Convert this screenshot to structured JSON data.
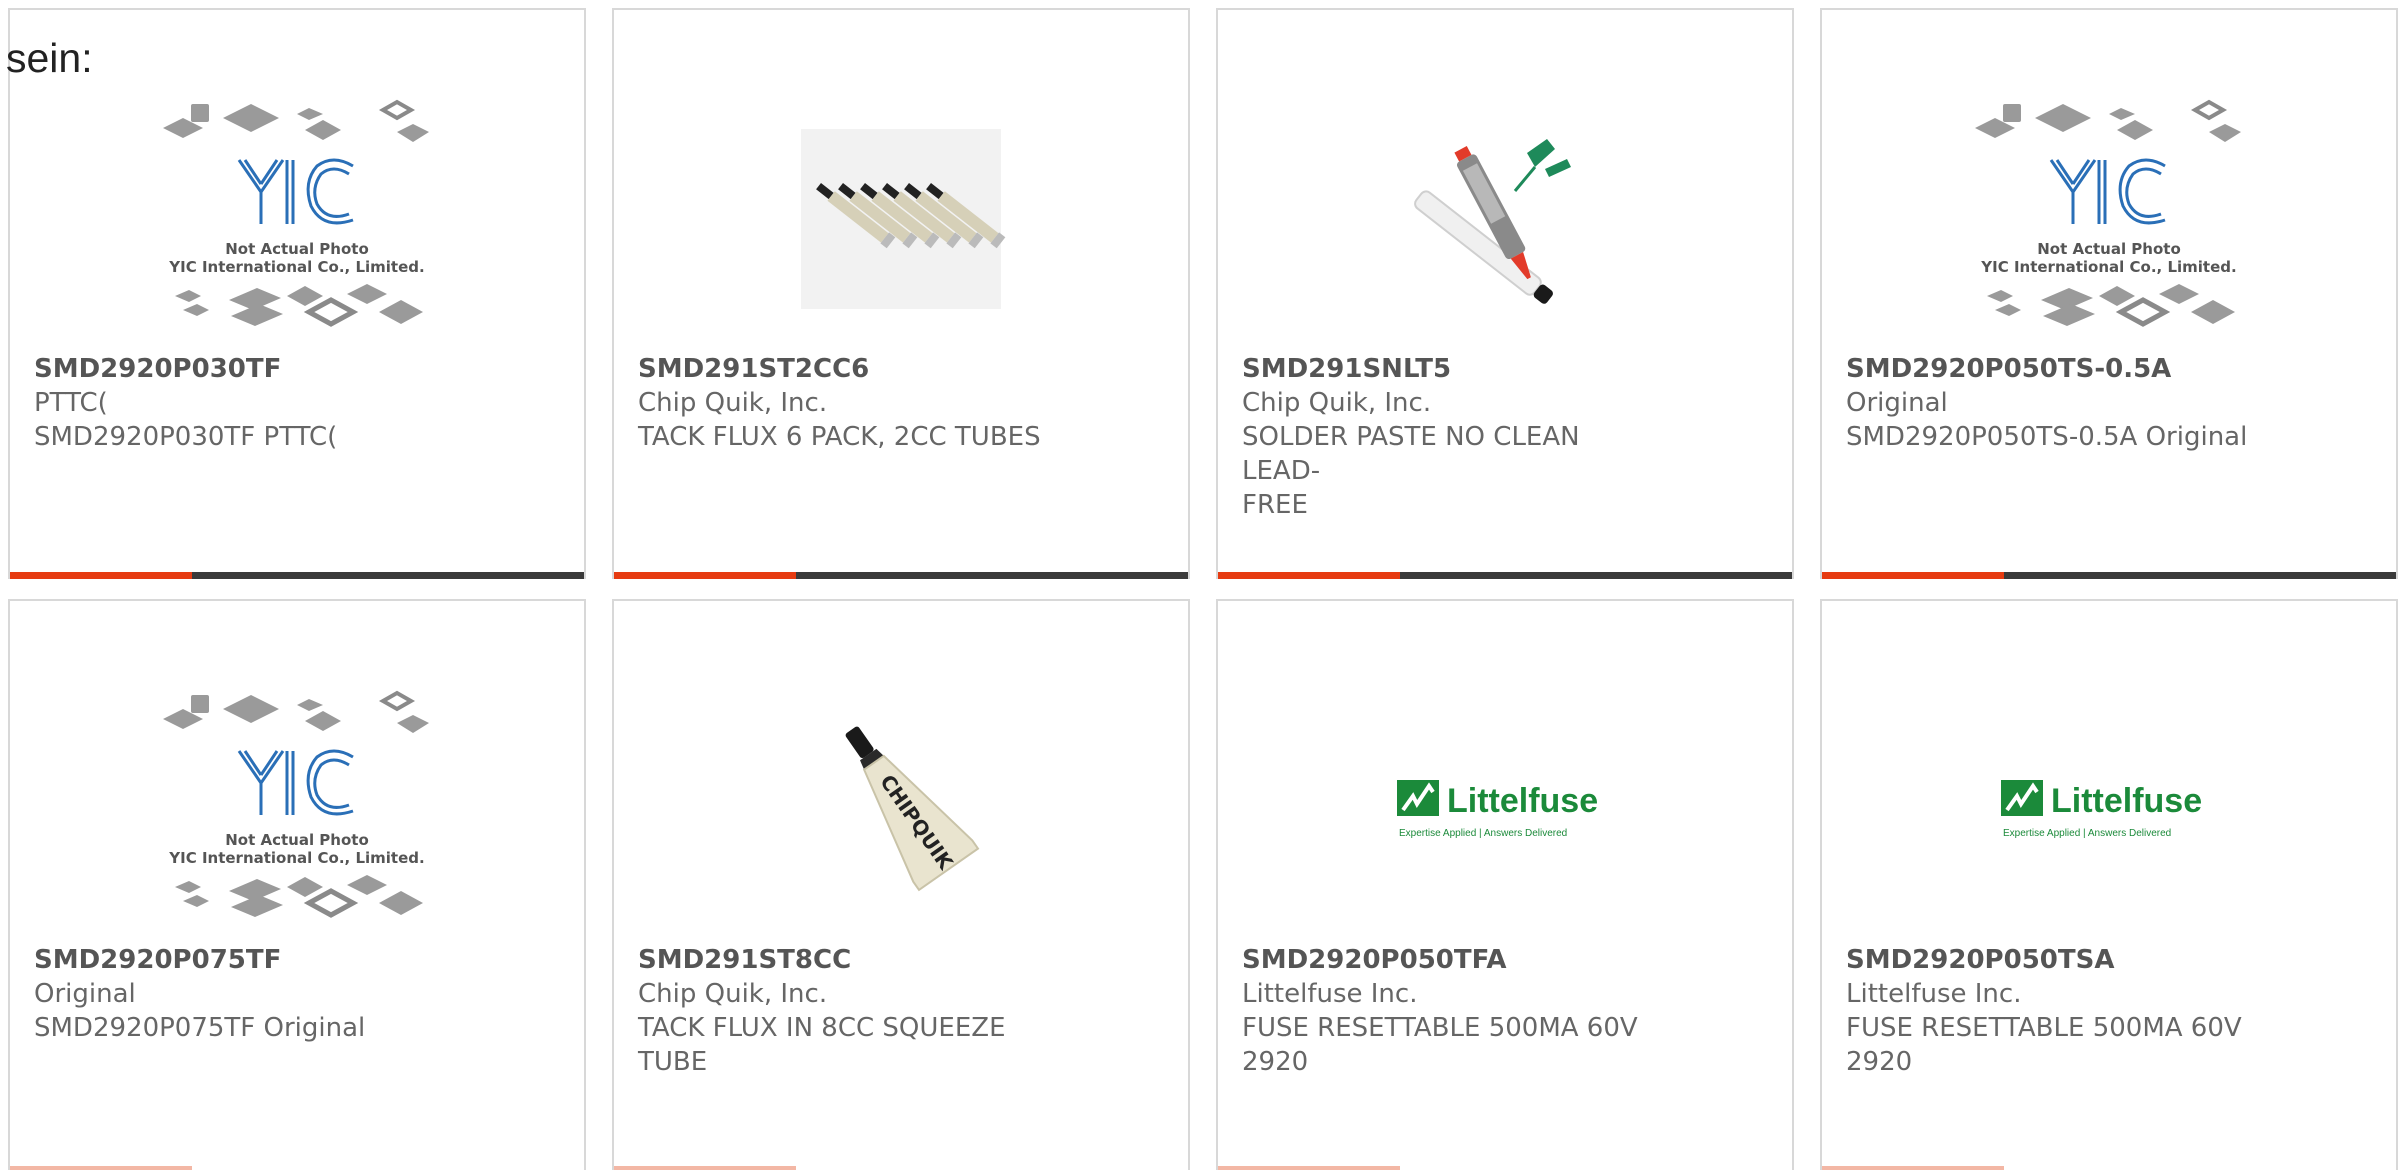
{
  "page": {
    "top_label": "sein:"
  },
  "products": [
    {
      "part_number": "SMD2920P030TF",
      "manufacturer": "PTTC(",
      "description": "SMD2920P030TF PTTC(",
      "image_icon": "yic-placeholder-image",
      "image_lines": [
        "Not Actual Photo",
        "YIC International Co., Limited."
      ]
    },
    {
      "part_number": "SMD291ST2CC6",
      "manufacturer": "Chip Quik, Inc.",
      "description": "TACK FLUX 6 PACK, 2CC TUBES",
      "image_icon": "flux-tubes-image"
    },
    {
      "part_number": "SMD291SNLT5",
      "manufacturer": "Chip Quik, Inc.",
      "description_lines": [
        "SOLDER PASTE NO CLEAN LEAD-",
        "FREE"
      ],
      "image_icon": "solder-syringe-image"
    },
    {
      "part_number": "SMD2920P050TS-0.5A",
      "manufacturer": "Original",
      "description": "SMD2920P050TS-0.5A Original",
      "image_icon": "yic-placeholder-image",
      "image_lines": [
        "Not Actual Photo",
        "YIC International Co., Limited."
      ]
    },
    {
      "part_number": "SMD2920P075TF",
      "manufacturer": "Original",
      "description": "SMD2920P075TF Original",
      "image_icon": "yic-placeholder-image",
      "image_lines": [
        "Not Actual Photo",
        "YIC International Co., Limited."
      ]
    },
    {
      "part_number": "SMD291ST8CC",
      "manufacturer": "Chip Quik, Inc.",
      "description_lines": [
        "TACK FLUX IN 8CC SQUEEZE",
        "TUBE"
      ],
      "image_icon": "chipquik-tube-image",
      "image_text": "CHIPQUIK"
    },
    {
      "part_number": "SMD2920P050TFA",
      "manufacturer": "Littelfuse Inc.",
      "description_lines": [
        "FUSE RESETTABLE 500MA 60V",
        "2920"
      ],
      "image_icon": "littelfuse-logo",
      "logo_text": "Littelfuse",
      "logo_tagline": "Expertise Applied | Answers Delivered"
    },
    {
      "part_number": "SMD2920P050TSA",
      "manufacturer": "Littelfuse Inc.",
      "description_lines": [
        "FUSE RESETTABLE 500MA 60V",
        "2920"
      ],
      "image_icon": "littelfuse-logo",
      "logo_text": "Littelfuse",
      "logo_tagline": "Expertise Applied | Answers Delivered"
    }
  ],
  "colors": {
    "accent": "#e63b11",
    "bar": "#3a3a3a",
    "border": "#d8d8d8",
    "text": "#666666",
    "yic_blue": "#2a6fb7",
    "littelfuse_green": "#1b8a3a"
  }
}
